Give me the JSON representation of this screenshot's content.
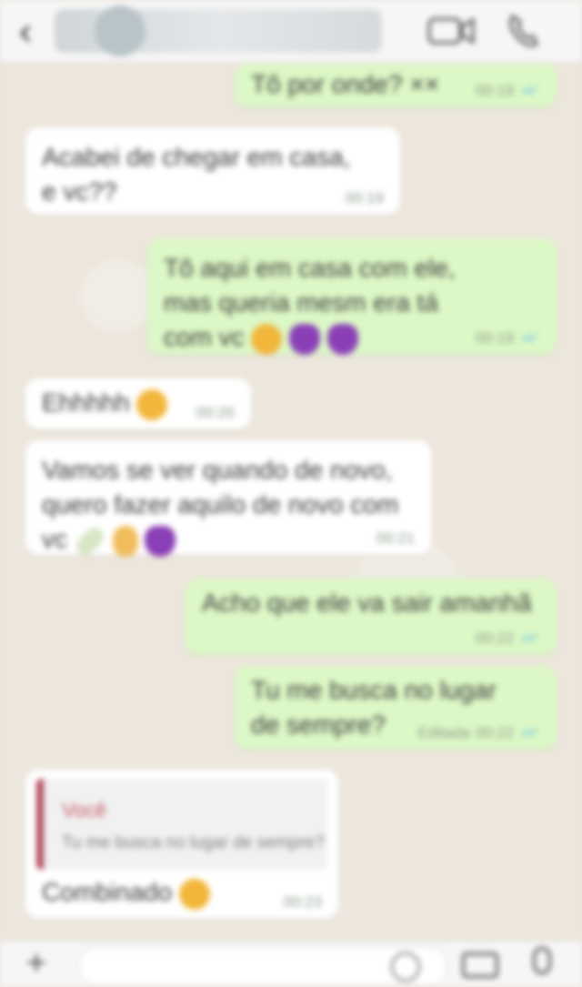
{
  "header": {
    "back_glyph": "‹",
    "contact_name": "",
    "video_icon": "video-camera-icon",
    "call_icon": "phone-icon"
  },
  "messages": [
    {
      "dir": "out",
      "text": "Tô por onde? ××",
      "time": "00:19",
      "ticks": true
    },
    {
      "dir": "in",
      "text": "Acabei de chegar em casa, e vc??",
      "time": "00:19"
    },
    {
      "dir": "out",
      "text": "Tô aqui em casa com ele, mas queria mesm era tá com vc",
      "time": "00:19",
      "ticks": true
    },
    {
      "dir": "in",
      "text": "Ehhhhh",
      "time": "00:20"
    },
    {
      "dir": "in",
      "text": "Vamos se ver quando de novo, quero fazer aquilo de novo com vc",
      "time": "00:21"
    },
    {
      "dir": "out",
      "text": "Acho que ele va sair amanhã",
      "time": "00:22",
      "ticks": true
    },
    {
      "dir": "out",
      "text": "Tu me busca no lugar de sempre?",
      "time": "00:22",
      "edited": "Editada",
      "ticks": true
    },
    {
      "dir": "in",
      "quote_author": "Você",
      "quote_text": "Tu me busca no lugar de sempre?",
      "text": "Combinado",
      "time": "00:23"
    }
  ],
  "input": {
    "placeholder": "",
    "plus_glyph": "+",
    "icons": [
      "plus-icon",
      "sticker-icon",
      "camera-icon",
      "microphone-icon"
    ]
  },
  "colors": {
    "outgoing_bubble": "#dcf8c6",
    "incoming_bubble": "#ffffff",
    "chat_wallpaper": "#ece6dc",
    "read_ticks": "#4fb6ec",
    "quote_bar": "#b24a5b"
  }
}
